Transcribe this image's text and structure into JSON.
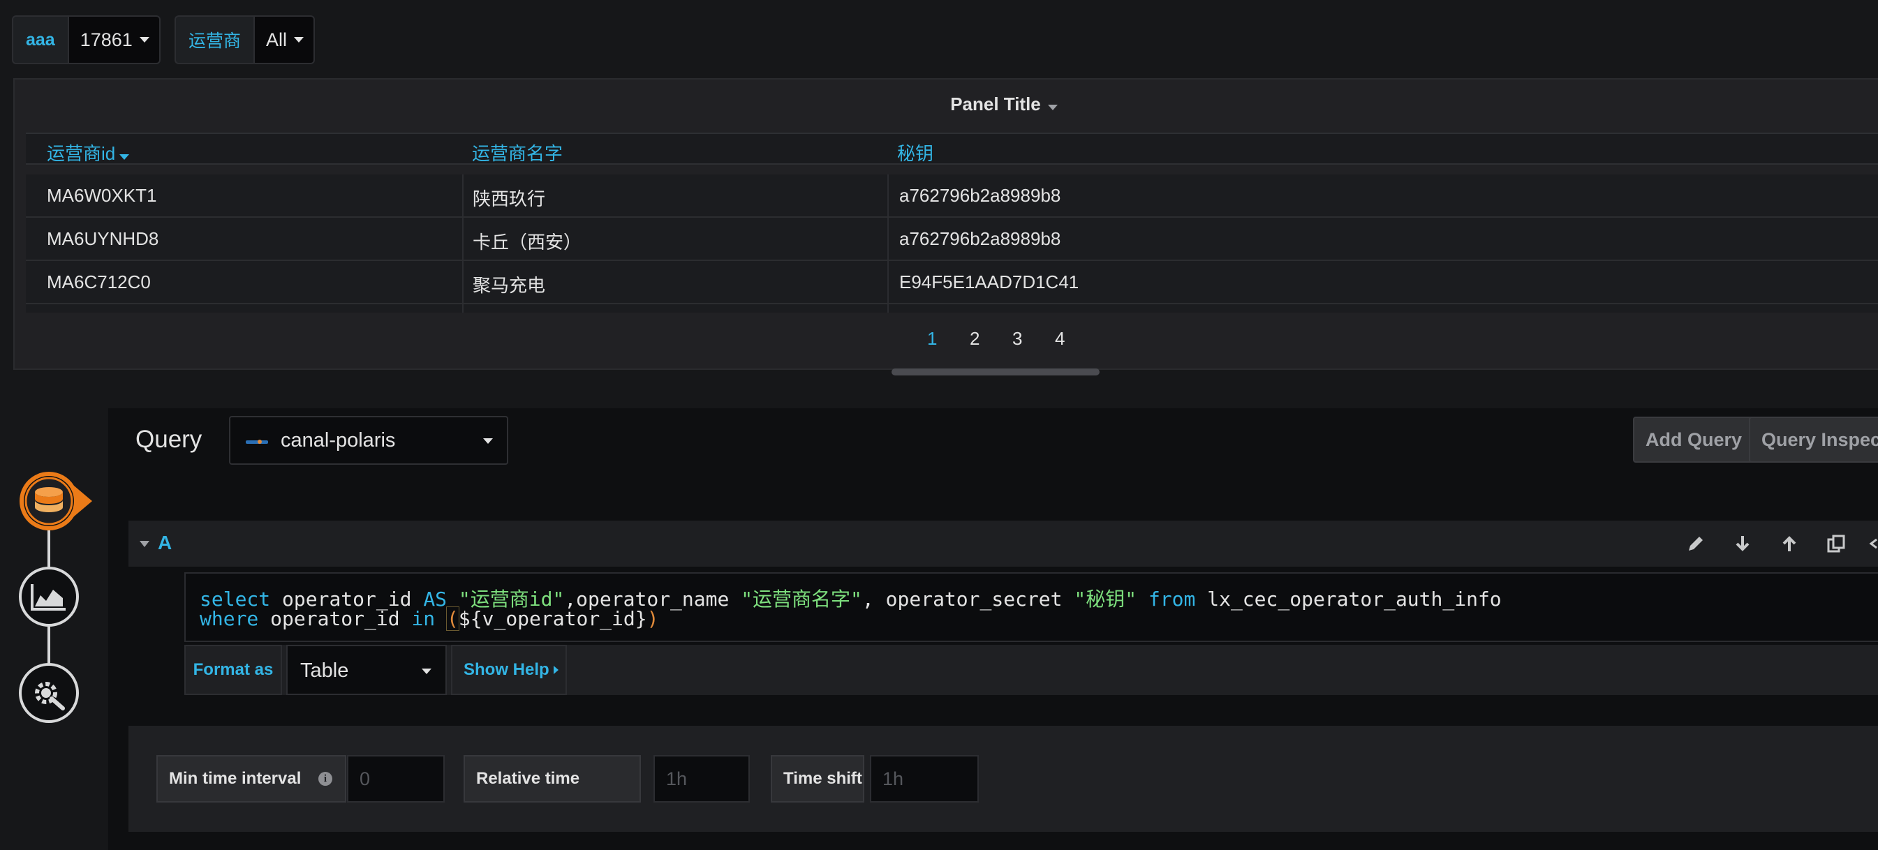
{
  "variables": [
    {
      "label": "aaa",
      "value": "17861"
    },
    {
      "label": "运营商",
      "value": "All"
    }
  ],
  "panel": {
    "title": "Panel Title",
    "columns": [
      "运营商id",
      "运营商名字",
      "秘钥"
    ],
    "rows": [
      [
        "MA6W0XKT1",
        "陕西玖行",
        "a762796b2a8989b8"
      ],
      [
        "MA6UYNHD8",
        "卡丘（西安）",
        "a762796b2a8989b8"
      ],
      [
        "MA6C712C0",
        "聚马充电",
        "E94F5E1AAD7D1C41"
      ]
    ],
    "pages": [
      "1",
      "2",
      "3",
      "4"
    ],
    "active_page": "1"
  },
  "query": {
    "title": "Query",
    "datasource": "canal-polaris",
    "add_query": "Add Query",
    "query_inspector": "Query Inspector",
    "ref_id": "A",
    "sql_line1": {
      "t1": "select",
      "t2": " operator_id ",
      "t3": "AS",
      "t4": " ",
      "t5": "\"运营商id\"",
      "t6": ",operator_name ",
      "t7": "\"运营商名字\"",
      "t8": ", operator_secret ",
      "t9": "\"秘钥\"",
      "t10": " ",
      "t11": "from",
      "t12": " lx_cec_operator_auth_info"
    },
    "sql_line2": {
      "t1": "where",
      "t2": " operator_id ",
      "t3": "in",
      "t4": " ",
      "t5": "(",
      "t6": "${v_operator_id}",
      "t7": ")"
    },
    "format_as_label": "Format as",
    "format_as_value": "Table",
    "show_help": "Show Help"
  },
  "options": {
    "min_interval_label": "Min time interval",
    "min_interval_placeholder": "0",
    "relative_time_label": "Relative time",
    "relative_time_placeholder": "1h",
    "time_shift_label": "Time shift",
    "time_shift_placeholder": "1h"
  },
  "colors": {
    "accent": "#33b5e5",
    "string": "#7ee07e",
    "brand_orange": "#eb7b18"
  },
  "icons": [
    "datasource-icon",
    "visualization-icon",
    "settings-icon",
    "edit-icon",
    "move-down-icon",
    "move-up-icon",
    "duplicate-icon"
  ]
}
